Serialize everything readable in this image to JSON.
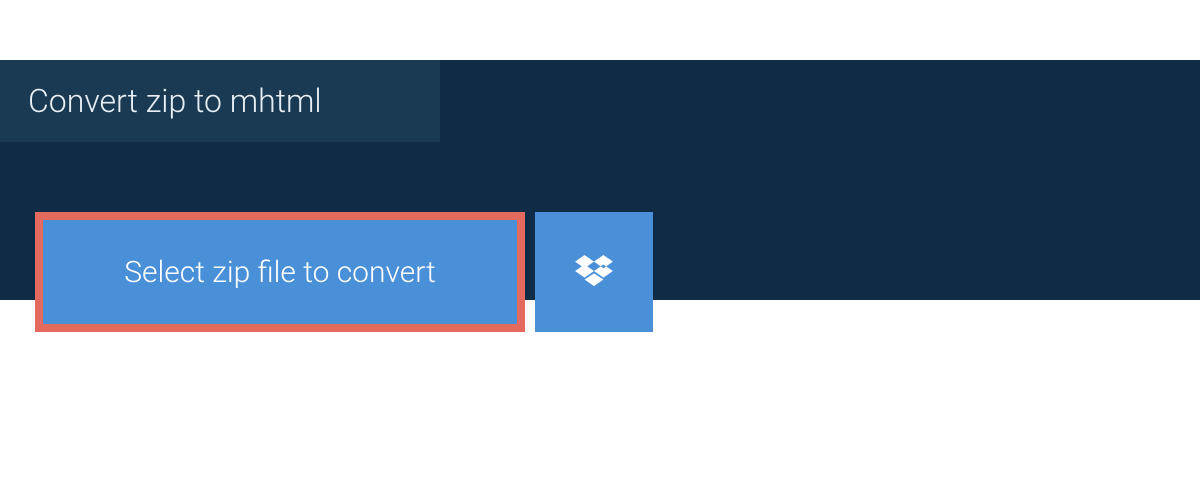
{
  "header": {
    "tab_label": "Convert zip to mhtml"
  },
  "actions": {
    "select_file_label": "Select zip file to convert"
  },
  "colors": {
    "panel_bg": "#0f2b45",
    "tab_bg": "#193a52",
    "button_bg": "#4a90d9",
    "button_border": "#e36a5c"
  }
}
